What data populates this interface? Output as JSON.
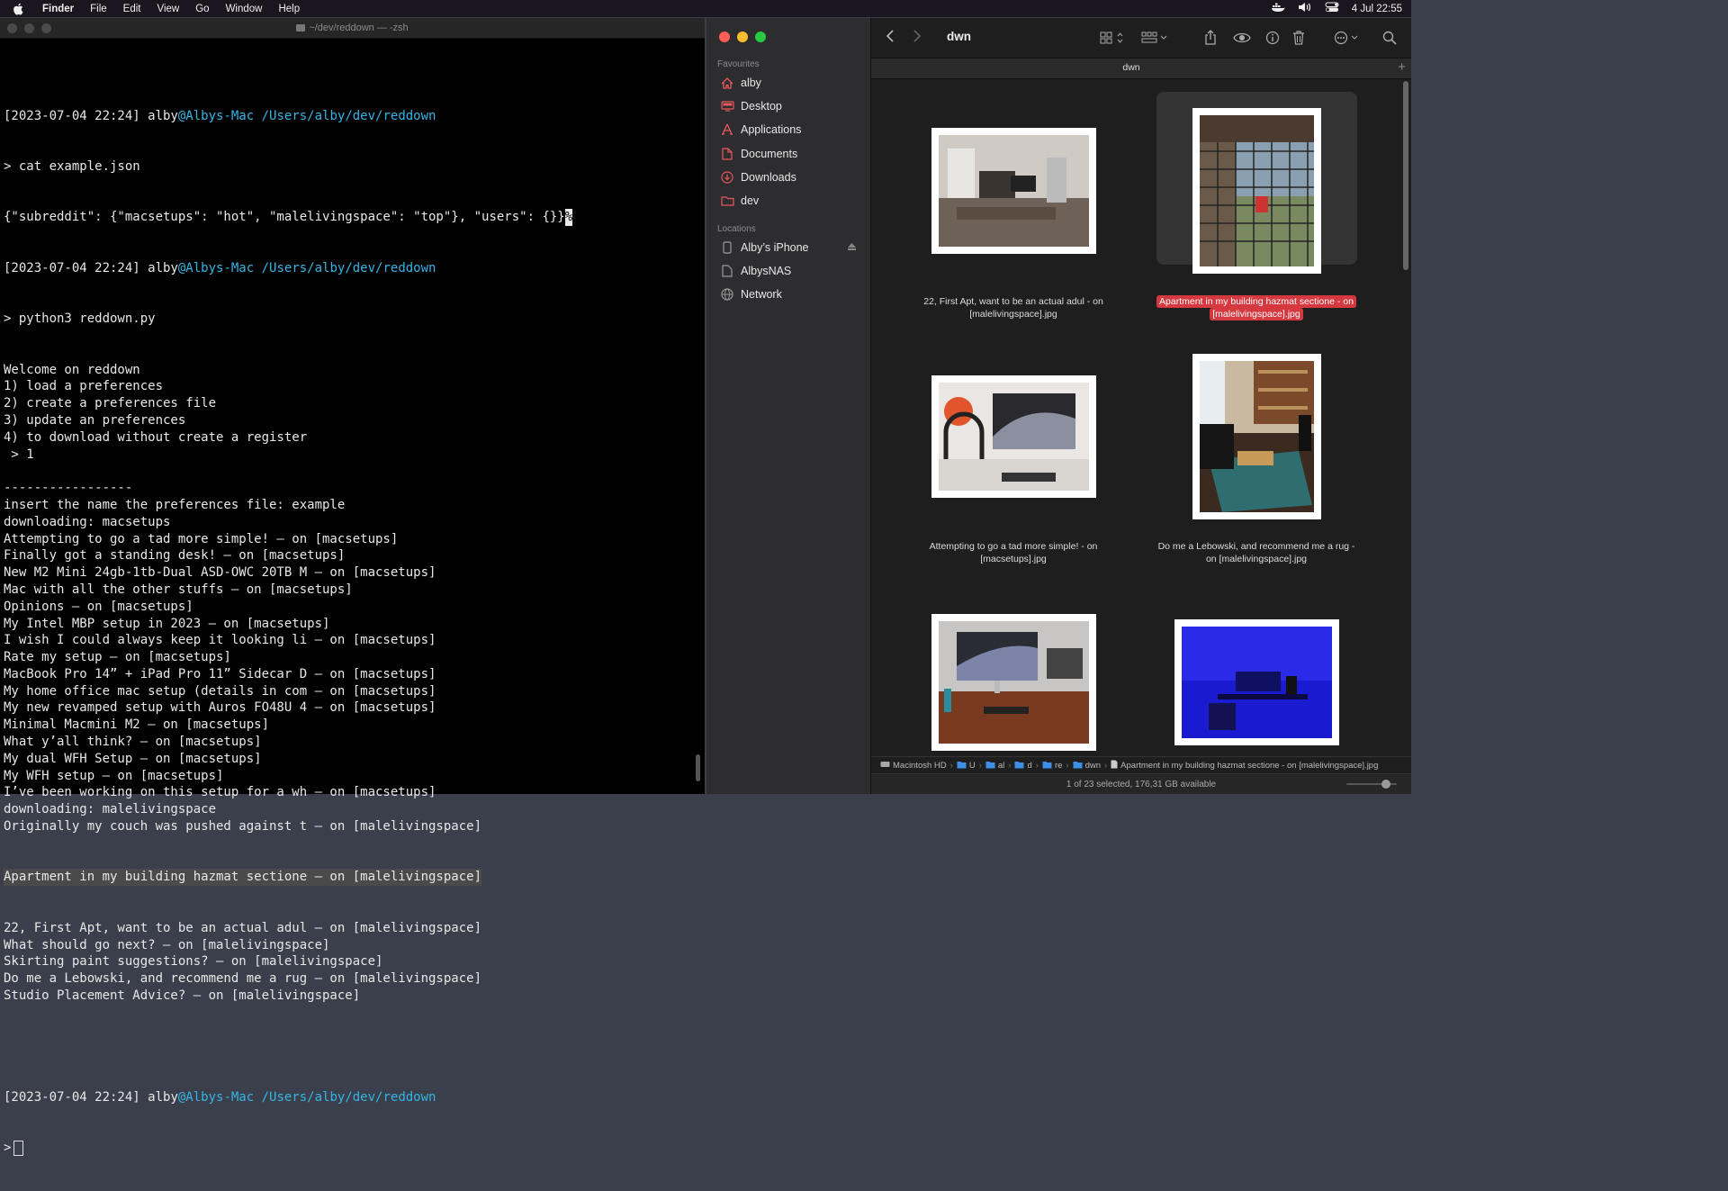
{
  "menubar": {
    "app": "Finder",
    "items": [
      "File",
      "Edit",
      "View",
      "Go",
      "Window",
      "Help"
    ],
    "clock": "4 Jul  22:55"
  },
  "terminal": {
    "title": "~/dev/reddown — -zsh",
    "prompt": {
      "date": "[2023-07-04 22:24]",
      "user": "alby",
      "host": "@Albys-Mac",
      "path": "/Users/alby/dev/reddown"
    },
    "cmd1": "> cat example.json",
    "json_out": "{\"subreddit\": {\"macsetups\": \"hot\", \"malelivingspace\": \"top\"}, \"users\": {}}",
    "json_end": "%",
    "cmd2": "> python3 reddown.py",
    "lines_a": [
      "Welcome on reddown",
      "1) load a preferences",
      "2) create a preferences file",
      "3) update an preferences",
      "4) to download without create a register",
      " > 1",
      "",
      "-----------------",
      "insert the name the preferences file: example",
      "downloading: macsetups",
      "Attempting to go a tad more simple! — on [macsetups]",
      "Finally got a standing desk! — on [macsetups]",
      "New M2 Mini 24gb-1tb-Dual ASD-OWC 20TB M — on [macsetups]",
      "Mac with all the other stuffs — on [macsetups]",
      "Opinions — on [macsetups]",
      "My Intel MBP setup in 2023 — on [macsetups]",
      "I wish I could always keep it looking li — on [macsetups]",
      "Rate my setup — on [macsetups]",
      "MacBook Pro 14” + iPad Pro 11” Sidecar D — on [macsetups]",
      "My home office mac setup (details in com — on [macsetups]",
      "My new revamped setup with Auros FO48U 4 — on [macsetups]",
      "Minimal Macmini M2 — on [macsetups]",
      "What y’all think? — on [macsetups]",
      "My dual WFH Setup — on [macsetups]",
      "My WFH setup — on [macsetups]",
      "I’ve been working on this setup for a wh — on [macsetups]",
      "downloading: malelivingspace",
      "Originally my couch was pushed against t — on [malelivingspace]"
    ],
    "highlight_line": "Apartment in my building hazmat sectione — on [malelivingspace]",
    "lines_b": [
      "22, First Apt, want to be an actual adul — on [malelivingspace]",
      "What should go next? — on [malelivingspace]",
      "Skirting paint suggestions? — on [malelivingspace]",
      "Do me a Lebowski, and recommend me a rug — on [malelivingspace]",
      "Studio Placement Advice? — on [malelivingspace]"
    ],
    "final_prompt": ">"
  },
  "finder": {
    "sidebar": {
      "favourites_label": "Favourites",
      "favourites": [
        {
          "label": "alby",
          "icon": "home-icon"
        },
        {
          "label": "Desktop",
          "icon": "desktop-icon"
        },
        {
          "label": "Applications",
          "icon": "applications-icon"
        },
        {
          "label": "Documents",
          "icon": "document-icon"
        },
        {
          "label": "Downloads",
          "icon": "download-icon"
        },
        {
          "label": "dev",
          "icon": "folder-icon"
        }
      ],
      "locations_label": "Locations",
      "locations": [
        {
          "label": "Alby’s iPhone",
          "icon": "phone-icon"
        },
        {
          "label": "AlbysNAS",
          "icon": "server-icon"
        },
        {
          "label": "Network",
          "icon": "network-icon"
        }
      ]
    },
    "toolbar": {
      "title": "dwn"
    },
    "tab": {
      "label": "dwn"
    },
    "items": [
      {
        "caption": "22, First Apt, want to be an actual adul - on [malelivingspace].jpg",
        "selected": false
      },
      {
        "caption": "Apartment in my building hazmat sectione - on [malelivingspace].jpg",
        "selected": true
      },
      {
        "caption": "Attempting to go a tad more simple! - on [macsetups].jpg",
        "selected": false
      },
      {
        "caption": "Do me a Lebowski, and recommend me a rug - on [malelivingspace].jpg",
        "selected": false
      },
      {
        "caption": "",
        "selected": false
      },
      {
        "caption": "",
        "selected": false
      }
    ],
    "pathbar": [
      "Macintosh HD",
      "U",
      "al",
      "d",
      "re",
      "dwn",
      "Apartment in my building hazmat sectione - on [malelivingspace].jpg"
    ],
    "status": "1 of 23 selected, 176,31 GB available",
    "colors": {
      "selection": "#d6383f",
      "accent": "#d6383f",
      "sidebar_icon": "#e8585f"
    }
  }
}
